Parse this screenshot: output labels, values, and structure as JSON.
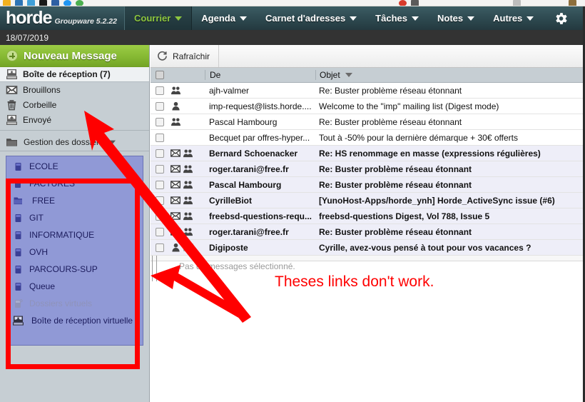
{
  "browser": {
    "bookmark_colors": [
      "#f2b01e",
      "#2e74b5",
      "#3f9fd8",
      "#1a1a1a",
      "#2e5fa3",
      "#2196f3",
      "#4caf50",
      "#d83b2b",
      "#5b5b5b",
      "#8d6e3c"
    ]
  },
  "header": {
    "brand_name": "horde",
    "brand_sub": "Groupware 5.2.22",
    "nav": [
      {
        "label": "Courrier",
        "active": true
      },
      {
        "label": "Agenda",
        "active": false
      },
      {
        "label": "Carnet d'adresses",
        "active": false
      },
      {
        "label": "Tâches",
        "active": false
      },
      {
        "label": "Notes",
        "active": false
      },
      {
        "label": "Autres",
        "active": false
      }
    ],
    "gear_icon": "gear-icon",
    "accent_color": "#8dc63f",
    "bar_color": "#2e4a51"
  },
  "datebar": {
    "date": "18/07/2019"
  },
  "sidebar": {
    "compose_label": "Nouveau Message",
    "compose_icon": "plus-circle-icon",
    "mailboxes": [
      {
        "label": "Boîte de réception (7)",
        "icon": "inbox-icon",
        "selected": true
      },
      {
        "label": "Brouillons",
        "icon": "drafts-envelope-icon",
        "selected": false
      },
      {
        "label": "Corbeille",
        "icon": "trash-icon",
        "selected": false
      },
      {
        "label": "Envoyé",
        "icon": "sent-icon",
        "selected": false
      }
    ],
    "management": {
      "label": "Gestion des dossiers",
      "icon": "folder-icon"
    },
    "folders": [
      {
        "label": "ECOLE",
        "icon": "folder-closed-icon",
        "muted": false,
        "indent": 0
      },
      {
        "label": "FACTURES",
        "icon": "folder-subscribed-icon",
        "muted": false,
        "indent": 0
      },
      {
        "label": "FREE",
        "icon": "folder-open-icon",
        "muted": false,
        "indent": 1
      },
      {
        "label": "GIT",
        "icon": "folder-closed-icon",
        "muted": false,
        "indent": 0
      },
      {
        "label": "INFORMATIQUE",
        "icon": "folder-closed-icon",
        "muted": false,
        "indent": 0
      },
      {
        "label": "OVH",
        "icon": "folder-closed-icon",
        "muted": false,
        "indent": 0
      },
      {
        "label": "PARCOURS-SUP",
        "icon": "folder-closed-icon",
        "muted": false,
        "indent": 0
      },
      {
        "label": "Queue",
        "icon": "folder-closed-icon",
        "muted": false,
        "indent": 0
      },
      {
        "label": "Dossiers virtuels",
        "icon": "folder-subscribed-icon",
        "muted": true,
        "indent": 0
      },
      {
        "label": "Boîte de réception virtuelle",
        "icon": "inbox-icon",
        "muted": false,
        "indent": 1
      }
    ],
    "highlight_color": "#ff0000",
    "folder_block_bg": "#9099d6"
  },
  "main": {
    "toolbar": {
      "refresh_label": "Rafraîchir",
      "refresh_icon": "refresh-icon"
    },
    "columns": {
      "from": "De",
      "subject": "Objet",
      "sort_icon": "sort-desc-caret-icon"
    },
    "messages": [
      {
        "from": "ajh-valmer",
        "subject": "Re: Buster problème réseau étonnant",
        "unread": false,
        "icons": [
          "group-icon"
        ]
      },
      {
        "from": "imp-request@lists.horde....",
        "subject": "Welcome to the \"imp\" mailing list (Digest mode)",
        "unread": false,
        "icons": [
          "person-icon"
        ]
      },
      {
        "from": "Pascal Hambourg",
        "subject": "Re: Buster problème réseau étonnant",
        "unread": false,
        "icons": [
          "group-icon"
        ]
      },
      {
        "from": "Becquet par offres-hyper...",
        "subject": "Tout à -50% pour la dernière démarque + 30€ offerts",
        "unread": false,
        "icons": []
      },
      {
        "from": "Bernard Schoenacker",
        "subject": "Re: HS renommage en masse (expressions régulières)",
        "unread": true,
        "icons": [
          "envelope-icon",
          "group-icon"
        ]
      },
      {
        "from": "roger.tarani@free.fr",
        "subject": "Re: Buster problème réseau étonnant",
        "unread": true,
        "icons": [
          "envelope-icon",
          "group-icon"
        ]
      },
      {
        "from": "Pascal Hambourg",
        "subject": "Re: Buster problème réseau étonnant",
        "unread": true,
        "icons": [
          "envelope-icon",
          "group-icon"
        ]
      },
      {
        "from": "CyrilleBiot",
        "subject": "[YunoHost-Apps/horde_ynh] Horde_ActiveSync issue (#6)",
        "unread": true,
        "icons": [
          "envelope-icon",
          "group-icon"
        ]
      },
      {
        "from": "freebsd-questions-requ...",
        "subject": "freebsd-questions Digest, Vol 788, Issue 5",
        "unread": true,
        "icons": [
          "envelope-icon",
          "group-icon"
        ]
      },
      {
        "from": "roger.tarani@free.fr",
        "subject": "Re: Buster problème réseau étonnant",
        "unread": true,
        "icons": [
          "envelope-icon",
          "group-icon"
        ]
      },
      {
        "from": "Digiposte",
        "subject": "Cyrille, avez-vous pensé à tout pour vos vacances ?",
        "unread": true,
        "icons": [
          "person-icon",
          "envelope-light-icon"
        ]
      }
    ],
    "preview_empty": "Pas de messages sélectionné."
  },
  "annotation": {
    "text": "Theses links don't work.",
    "color": "#ff0000"
  }
}
